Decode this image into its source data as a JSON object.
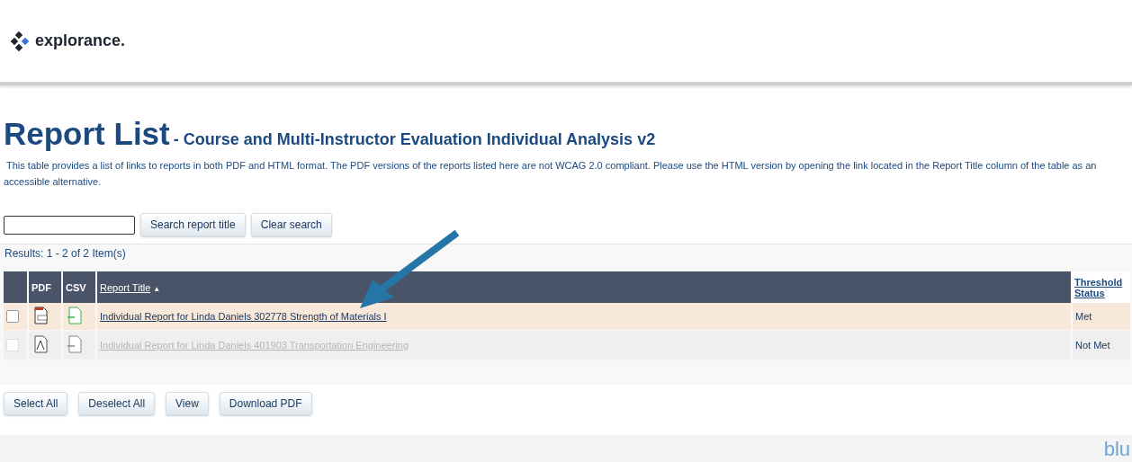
{
  "header": {
    "logo_text": "explorance."
  },
  "title": "Report List",
  "subtitle": "- Course and Multi-Instructor Evaluation Individual Analysis v2",
  "description": "This table provides a list of links to reports in both PDF and HTML format. The PDF versions of the reports listed here are not WCAG 2.0 compliant. Please use the HTML version by opening the link located in the Report Title column of the table as an accessible alternative.",
  "search": {
    "buttons": [
      "Search report title",
      "Clear search"
    ]
  },
  "results": "Results: 1 - 2 of 2 Item(s)",
  "table": {
    "columns": [
      "PDF",
      "CSV",
      "Report Title",
      "Threshold Status"
    ],
    "sort_indicator": "▲",
    "rows": [
      {
        "title": "Individual Report for Linda Daniels 302778 Strength of Materials I",
        "status": "Met",
        "checked": false,
        "disabled": false,
        "highlighted": true
      },
      {
        "title": "Individual Report for Linda Daniels 401903 Transportation Engineering",
        "status": "Not Met",
        "checked": false,
        "disabled": true,
        "highlighted": false
      }
    ]
  },
  "actions": [
    "Select All",
    "Deselect All",
    "View",
    "Download PDF"
  ],
  "footer": {
    "brand": "blu"
  }
}
